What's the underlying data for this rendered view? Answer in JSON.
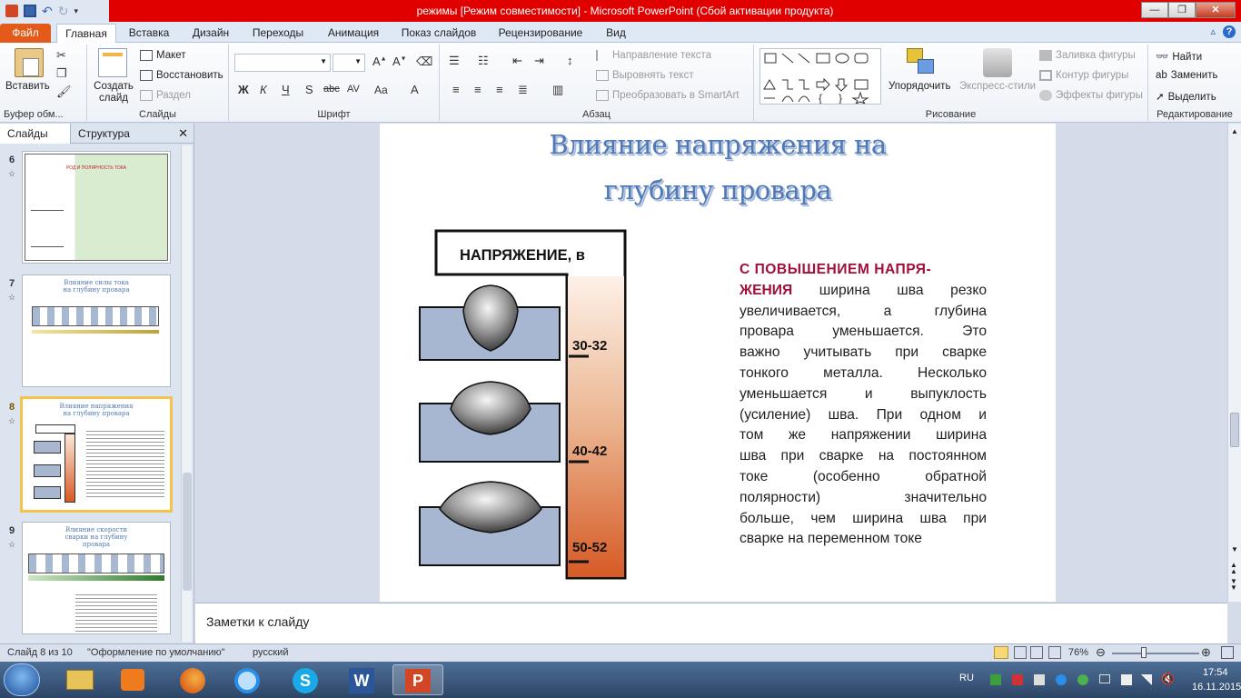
{
  "window": {
    "title": "режимы [Режим совместимости]  -  Microsoft PowerPoint (Сбой активации продукта)"
  },
  "tabs": [
    "Файл",
    "Главная",
    "Вставка",
    "Дизайн",
    "Переходы",
    "Анимация",
    "Показ слайдов",
    "Рецензирование",
    "Вид"
  ],
  "ribbon": {
    "clipboard": {
      "paste": "Вставить",
      "label": "Буфер обм..."
    },
    "slides": {
      "new_slide": "Создать слайд",
      "layout": "Макет",
      "reset": "Восстановить",
      "section": "Раздел",
      "label": "Слайды"
    },
    "font": {
      "label": "Шрифт",
      "bold": "Ж",
      "italic": "К",
      "underline": "Ч",
      "strike": "abc",
      "shadow": "S",
      "spacing": "AV",
      "case": "Aa",
      "color": "A"
    },
    "paragraph": {
      "text_direction": "Направление текста",
      "align_text": "Выровнять текст",
      "smartart": "Преобразовать в SmartArt",
      "label": "Абзац"
    },
    "drawing": {
      "arrange": "Упорядочить",
      "quick_styles": "Экспресс-стили",
      "fill": "Заливка фигуры",
      "outline": "Контур фигуры",
      "effects": "Эффекты фигуры",
      "label": "Рисование"
    },
    "editing": {
      "find": "Найти",
      "replace": "Заменить",
      "select": "Выделить",
      "label": "Редактирование"
    }
  },
  "pane": {
    "tab_slides": "Слайды",
    "tab_outline": "Структура",
    "thumbnails": [
      {
        "num": "6",
        "title": "РОД И ПОЛЯРНОСТЬ ТОКА"
      },
      {
        "num": "7",
        "title": "Влияние силы тока на глубину провара"
      },
      {
        "num": "8",
        "title": "Влияние напряжения на глубину провара"
      },
      {
        "num": "9",
        "title": "Влияние скорости сварки на глубину провара"
      }
    ]
  },
  "slide": {
    "title_line1": "Влияние напряжения на",
    "title_line2": "глубину провара",
    "header": "НАПРЯЖЕНИЕ, в",
    "scale": [
      "30-32",
      "40-42",
      "50-52"
    ],
    "text_highlight": "С ПОВЫШЕНИЕМ НАПРЯ-ЖЕНИЯ",
    "text_lines": [
      "С ПОВЫШЕНИЕМ НАПРЯ-",
      "ЖЕНИЯ ширина шва резко",
      "увеличивается, а глубина",
      "провара уменьшается. Это",
      "важно учитывать при сварке",
      "тонкого металла. Несколько",
      "уменьшается и выпуклость",
      "(усиление) шва. При одном и",
      "том же напряжении ширина",
      "шва при сварке на постоянном",
      "токе (особенно обратной",
      "полярности) значительно",
      "больше, чем ширина шва при",
      "сварке на переменном токе"
    ]
  },
  "notes": {
    "placeholder": "Заметки к слайду"
  },
  "status": {
    "slide_info": "Слайд 8 из 10",
    "theme": "\"Оформление по умолчанию\"",
    "language": "русский",
    "zoom": "76%"
  },
  "tray": {
    "lang": "RU",
    "time": "17:54",
    "date": "16.11.2015"
  },
  "colors": {
    "titlebar": "#e00000",
    "file_tab": "#e45a1b",
    "slide_title": "#4f79b6",
    "highlight_text": "#a0103a",
    "scale_gradient_top": "#fbe7d8",
    "scale_gradient_bottom": "#d65a25"
  }
}
